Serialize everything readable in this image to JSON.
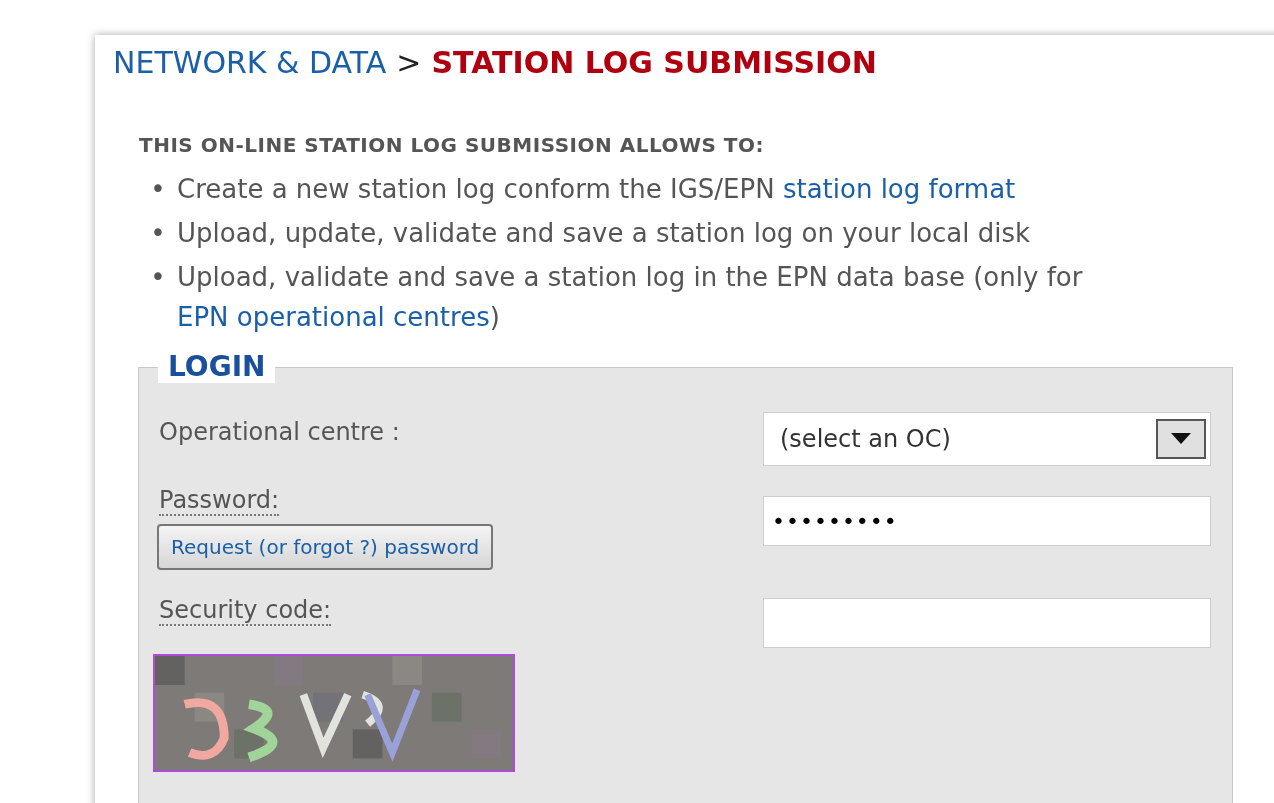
{
  "breadcrumb": {
    "parent": "NETWORK & DATA",
    "separator": ">",
    "current": "STATION LOG SUBMISSION"
  },
  "intro": {
    "heading": "THIS ON-LINE STATION LOG SUBMISSION ALLOWS TO:",
    "items": [
      {
        "bullet": "•",
        "parts": [
          {
            "text": "Create a new station log conform the IGS/EPN "
          },
          {
            "text": "station log format",
            "link": true
          }
        ]
      },
      {
        "bullet": "•",
        "parts": [
          {
            "text": "Upload, update, validate and save a station log on your local disk"
          }
        ]
      },
      {
        "bullet": "•",
        "parts": [
          {
            "text": "Upload, validate and save a station log in the EPN data base (only for "
          },
          {
            "text": "EPN operational centres",
            "link": true
          },
          {
            "text": ")"
          }
        ]
      }
    ]
  },
  "login": {
    "legend": "LOGIN",
    "operational_centre": {
      "label": "Operational centre :",
      "value": "(select an OC)"
    },
    "password": {
      "label": "Password:",
      "value": "•••••••••",
      "button": "Request (or forgot ?) password"
    },
    "security_code": {
      "label": "Security code:"
    }
  }
}
